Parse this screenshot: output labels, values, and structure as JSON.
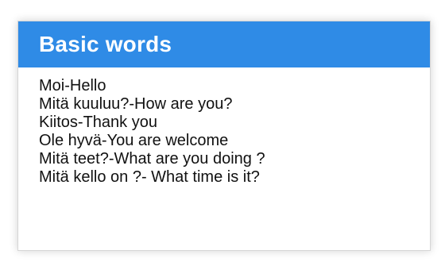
{
  "card": {
    "title": "Basic words",
    "lines": [
      "Moi-Hello",
      "Mitä kuuluu?-How are you?",
      "Kiitos-Thank you",
      "Ole hyvä-You are welcome",
      "Mitä teet?-What are you doing ?",
      "Mitä kello on ?- What time is it?"
    ]
  },
  "colors": {
    "header_bg": "#2f8be6",
    "title_text": "#ffffff",
    "body_text": "#111111"
  }
}
